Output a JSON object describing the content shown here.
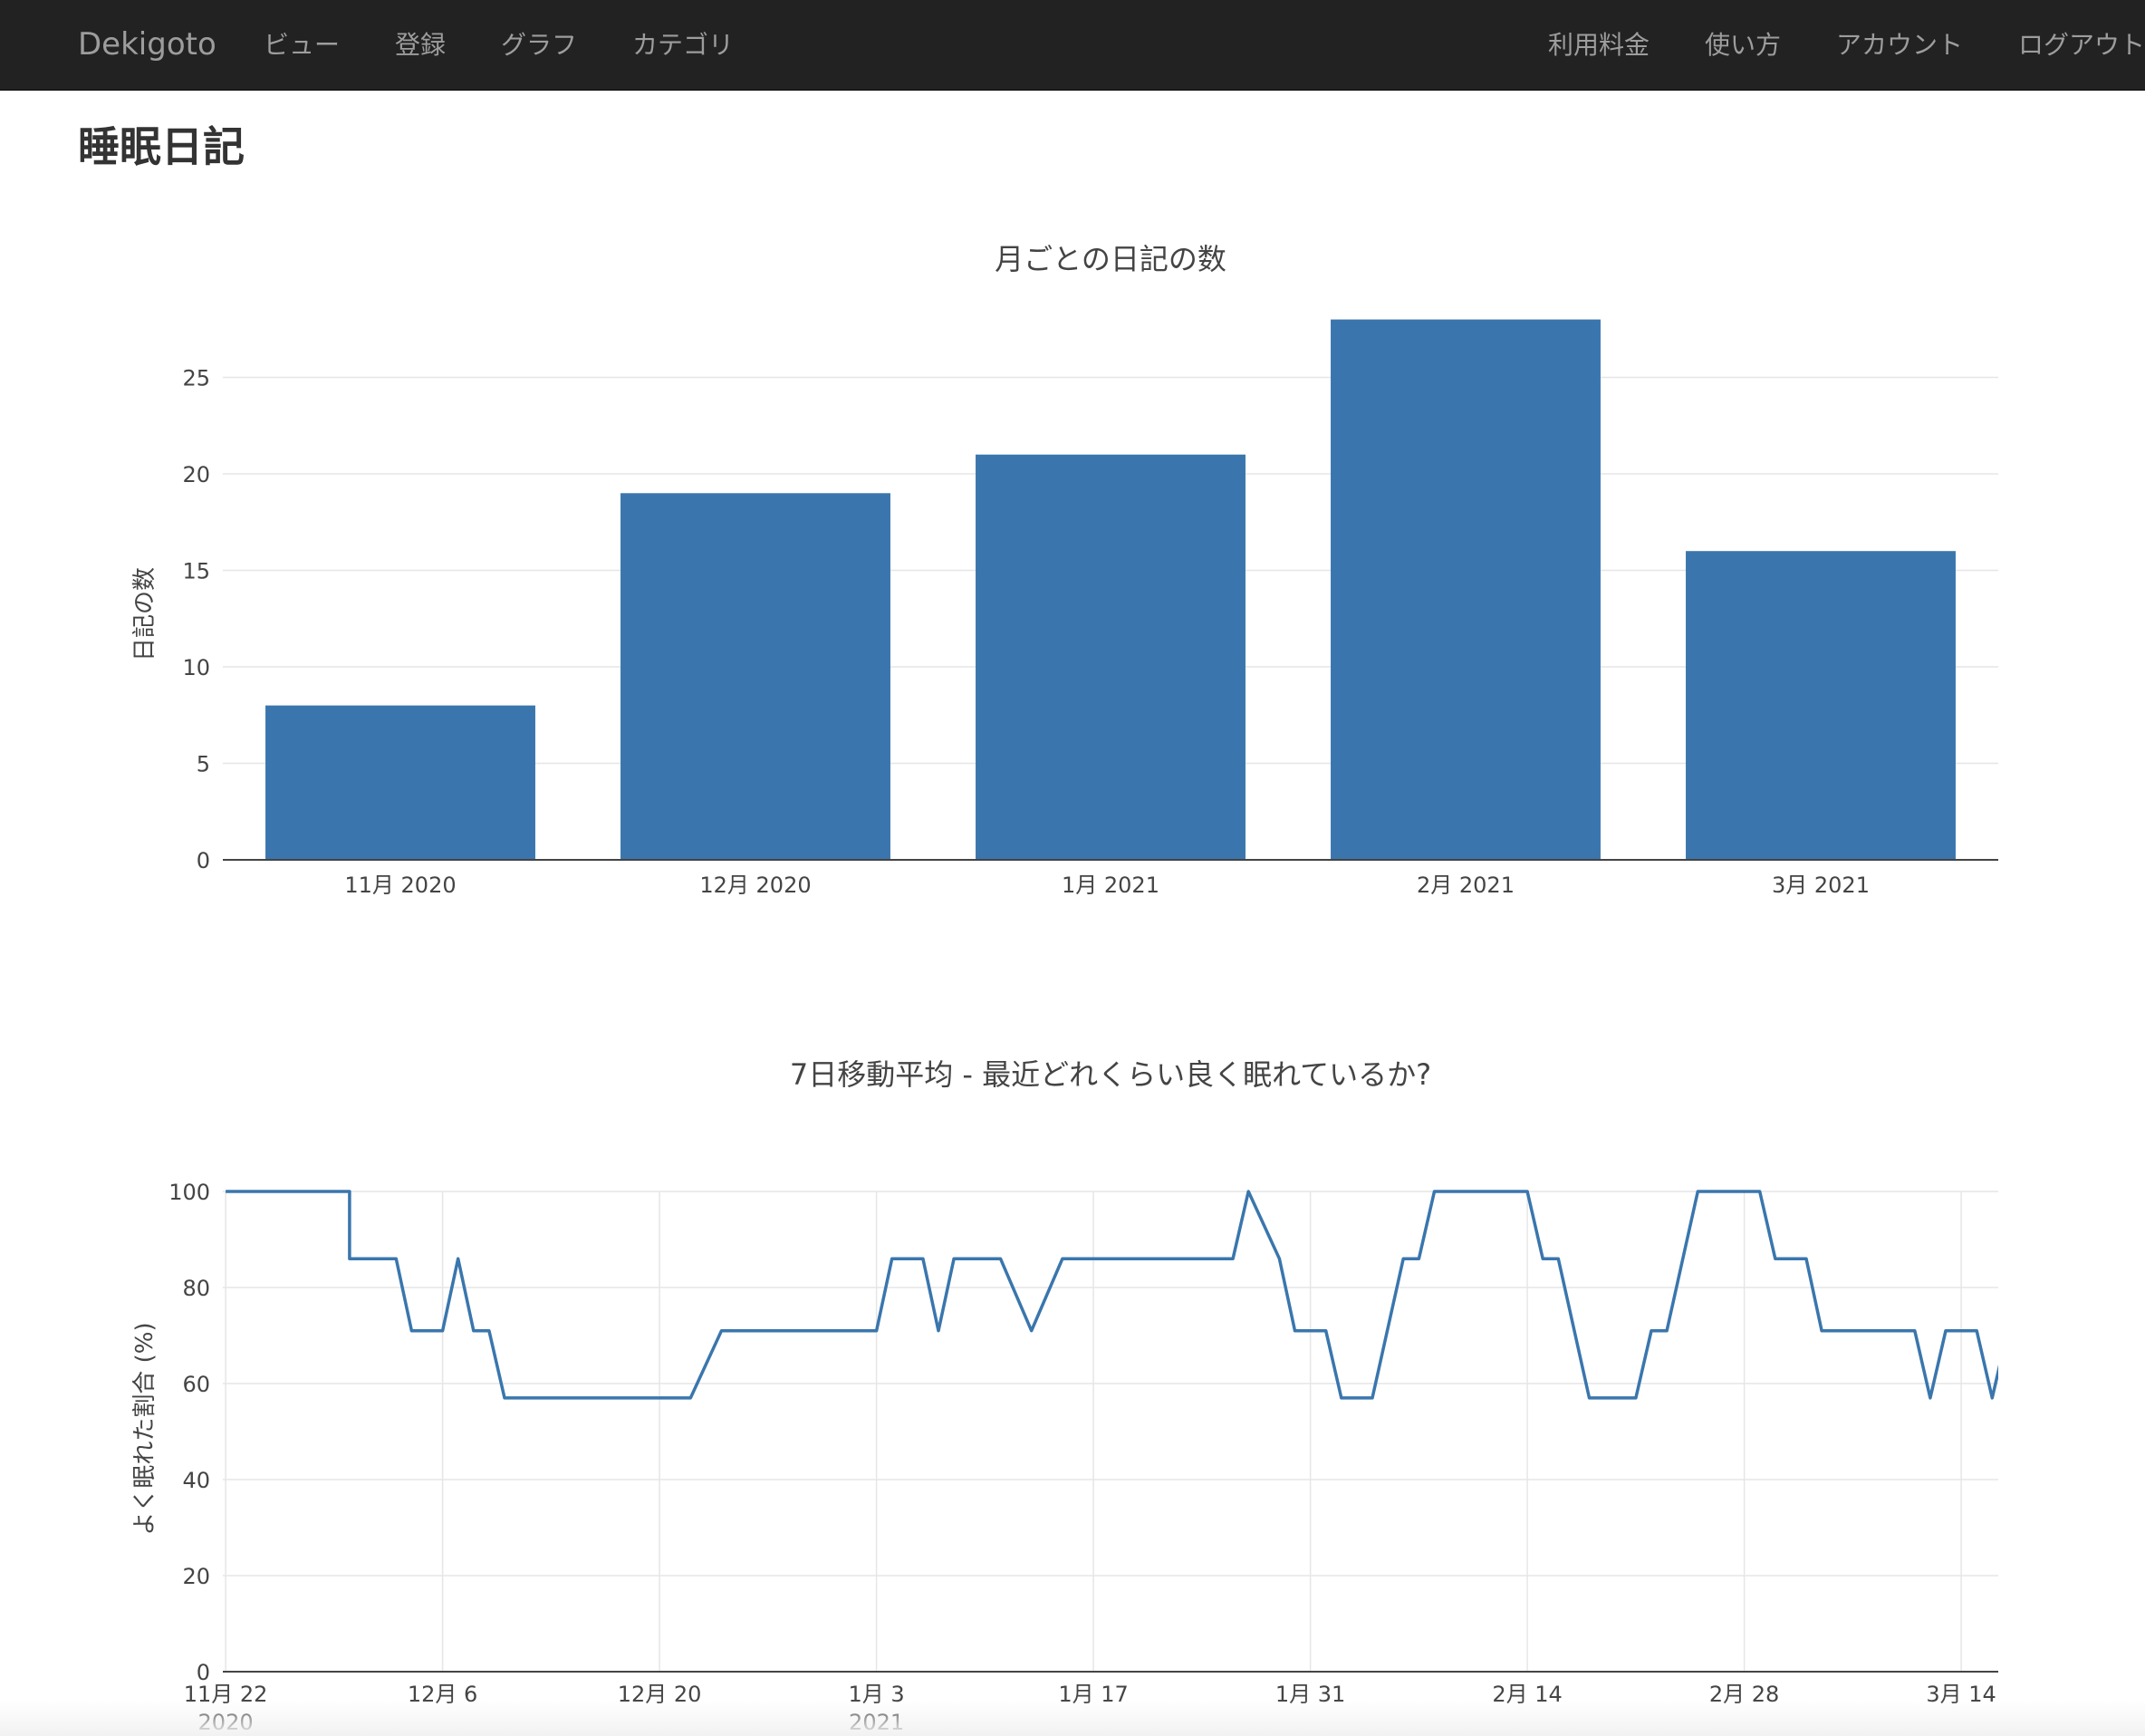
{
  "navbar": {
    "brand": "Dekigoto",
    "left_items": [
      {
        "label": "ビュー"
      },
      {
        "label": "登録"
      },
      {
        "label": "グラフ"
      },
      {
        "label": "カテゴリ"
      }
    ],
    "right_items": [
      {
        "label": "利用料金"
      },
      {
        "label": "使い方"
      },
      {
        "label": "アカウント"
      },
      {
        "label": "ログアウト"
      }
    ]
  },
  "page": {
    "title": "睡眠日記"
  },
  "chart_data": [
    {
      "type": "bar",
      "title": "月ごとの日記の数",
      "xlabel": "",
      "ylabel": "日記の数",
      "categories": [
        "11月 2020",
        "12月 2020",
        "1月 2021",
        "2月 2021",
        "3月 2021"
      ],
      "values": [
        8,
        19,
        21,
        28,
        16
      ],
      "ylim": [
        0,
        30
      ],
      "yticks": [
        0,
        5,
        10,
        15,
        20,
        25
      ],
      "color": "#3a76ad",
      "grid": "horizontal"
    },
    {
      "type": "line",
      "title": "7日移動平均 - 最近どれくらい良く眠れているか?",
      "xlabel": "",
      "ylabel": "よく眠れた割合 (%)",
      "ylim": [
        0,
        100
      ],
      "yticks": [
        0,
        20,
        40,
        60,
        80,
        100
      ],
      "x_range": [
        "2020-11-22",
        "2021-03-16"
      ],
      "xticks": [
        {
          "date": "2020-11-22",
          "label": "11月 22",
          "sublabel": "2020"
        },
        {
          "date": "2020-12-06",
          "label": "12月 6",
          "sublabel": ""
        },
        {
          "date": "2020-12-20",
          "label": "12月 20",
          "sublabel": ""
        },
        {
          "date": "2021-01-03",
          "label": "1月 3",
          "sublabel": "2021"
        },
        {
          "date": "2021-01-17",
          "label": "1月 17",
          "sublabel": ""
        },
        {
          "date": "2021-01-31",
          "label": "1月 31",
          "sublabel": ""
        },
        {
          "date": "2021-02-14",
          "label": "2月 14",
          "sublabel": ""
        },
        {
          "date": "2021-02-28",
          "label": "2月 28",
          "sublabel": ""
        },
        {
          "date": "2021-03-14",
          "label": "3月 14",
          "sublabel": ""
        }
      ],
      "color": "#3a76ad",
      "grid": "both",
      "series": [
        {
          "x": [
            "2020-11-22",
            "2020-11-30",
            "2020-11-30",
            "2020-12-03",
            "2020-12-04",
            "2020-12-06",
            "2020-12-07",
            "2020-12-08",
            "2020-12-09",
            "2020-12-10",
            "2020-12-22",
            "2020-12-24",
            "2021-01-03",
            "2021-01-04",
            "2021-01-06",
            "2021-01-07",
            "2021-01-08",
            "2021-01-11",
            "2021-01-13",
            "2021-01-15",
            "2021-01-26",
            "2021-01-27",
            "2021-01-29",
            "2021-01-30",
            "2021-02-01",
            "2021-02-02",
            "2021-02-04",
            "2021-02-06",
            "2021-02-07",
            "2021-02-08",
            "2021-02-14",
            "2021-02-15",
            "2021-02-16",
            "2021-02-18",
            "2021-02-21",
            "2021-02-22",
            "2021-02-23",
            "2021-02-25",
            "2021-03-01",
            "2021-03-02",
            "2021-03-04",
            "2021-03-05",
            "2021-03-11",
            "2021-03-12",
            "2021-03-13",
            "2021-03-15",
            "2021-03-16",
            "2021-03-17"
          ],
          "y": [
            100,
            100,
            86,
            86,
            71,
            71,
            86,
            71,
            71,
            57,
            57,
            71,
            71,
            86,
            86,
            71,
            86,
            86,
            71,
            86,
            86,
            100,
            86,
            71,
            71,
            57,
            57,
            86,
            86,
            100,
            100,
            86,
            86,
            57,
            57,
            71,
            71,
            100,
            100,
            86,
            86,
            71,
            71,
            57,
            71,
            71,
            57,
            71
          ]
        }
      ]
    }
  ]
}
